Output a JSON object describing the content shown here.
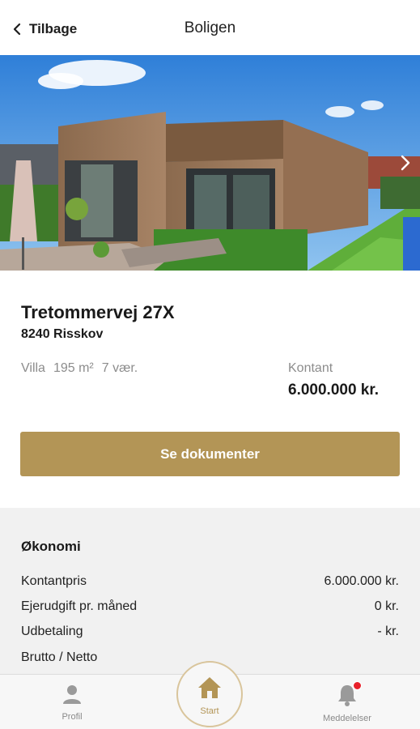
{
  "header": {
    "back_label": "Tilbage",
    "title": "Boligen"
  },
  "property": {
    "address": "Tretommervej 27X",
    "city": "8240 Risskov",
    "type": "Villa",
    "area": "195 m²",
    "rooms": "7 vær.",
    "price_label": "Kontant",
    "price_value": "6.000.000 kr."
  },
  "actions": {
    "documents_label": "Se dokumenter"
  },
  "economy": {
    "title": "Økonomi",
    "rows": [
      {
        "label": "Kontantpris",
        "value": "6.000.000 kr."
      },
      {
        "label": "Ejerudgift pr. måned",
        "value": "0 kr."
      },
      {
        "label": "Udbetaling",
        "value": "- kr."
      },
      {
        "label": "Brutto / Netto",
        "value": ""
      }
    ]
  },
  "tabbar": {
    "profile_label": "Profil",
    "start_label": "Start",
    "notifications_label": "Meddelelser"
  },
  "icons": {
    "back": "chevron-left-icon",
    "next": "chevron-right-icon",
    "profile": "person-icon",
    "start": "home-icon",
    "notifications": "bell-icon"
  },
  "colors": {
    "accent": "#b39556",
    "badge": "#e8202a",
    "section_bg": "#f1f1f1"
  }
}
